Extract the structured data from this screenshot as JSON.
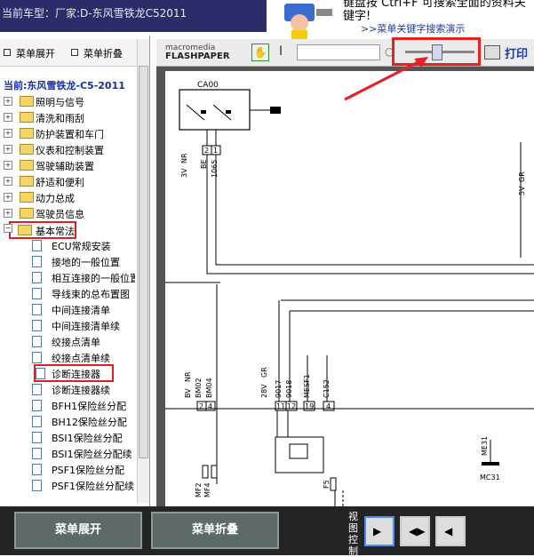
{
  "header": {
    "car_model": "当前车型：厂家:D-东风雪铁龙C52011",
    "tip_text": "键盘按 Ctrl+F 可搜索全面的资料关键字!",
    "tip_link": ">>菜单关键字搜索演示"
  },
  "left_panel": {
    "tab_expand": "菜单展开",
    "tab_collapse": "菜单折叠",
    "current": "当前:东风雪铁龙-C5-2011",
    "folders": [
      {
        "label": "照明与信号"
      },
      {
        "label": "清洗和雨刮"
      },
      {
        "label": "防护装置和车门"
      },
      {
        "label": "仪表和控制装置"
      },
      {
        "label": "驾驶辅助装置"
      },
      {
        "label": "舒适和便利"
      },
      {
        "label": "动力总成"
      },
      {
        "label": "驾驶员信息"
      },
      {
        "label": "基本常法"
      }
    ],
    "docs": [
      {
        "label": "ECU常规安装"
      },
      {
        "label": "接地的一般位置"
      },
      {
        "label": "相互连接的一般位置"
      },
      {
        "label": "导线束的总布置图"
      },
      {
        "label": "中间连接清单"
      },
      {
        "label": "中间连接清单续"
      },
      {
        "label": "绞接点清单"
      },
      {
        "label": "绞接点清单续"
      },
      {
        "label": "诊断连接器"
      },
      {
        "label": "诊断连接器续"
      },
      {
        "label": "BFH1保险丝分配"
      },
      {
        "label": "BH12保险丝分配"
      },
      {
        "label": "BSI1保险丝分配"
      },
      {
        "label": "BSI1保险丝分配续"
      },
      {
        "label": "PSF1保险丝分配"
      },
      {
        "label": "PSF1保险丝分配续"
      }
    ]
  },
  "viewer": {
    "logo_top": "macromedia",
    "logo_bottom": "FLASHPAPER",
    "print_label": "打印",
    "zoom_level": 0.4
  },
  "diagram": {
    "ca00": "CA00",
    "pins": [
      "2",
      "1"
    ],
    "wire_labels": [
      "3V",
      "NR",
      "BE",
      "1065"
    ],
    "conn_left": [
      "BV",
      "NR",
      "BM04",
      "BM02"
    ],
    "conn_right": [
      "28V",
      "GR",
      "9017",
      "9018",
      "MESF1",
      "C152"
    ],
    "mid_pins": [
      "2",
      "4",
      "11",
      "12",
      "19",
      "4"
    ],
    "right_labels": [
      "5V",
      "GR"
    ],
    "me31": "ME31",
    "mc31": "MC31",
    "mf2": "MF2",
    "mf4": "MF4",
    "f5": "F5"
  },
  "bottom": {
    "expand_label": "菜单展开",
    "collapse_label": "菜单折叠",
    "view_control": "视图控制"
  }
}
